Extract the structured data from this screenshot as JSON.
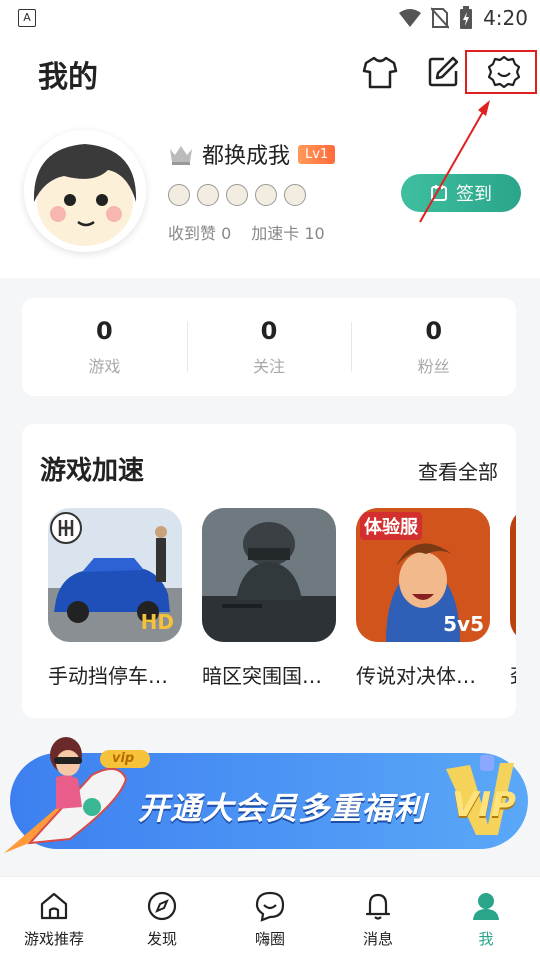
{
  "status": {
    "app_icon_letter": "A",
    "time": "4:20"
  },
  "header": {
    "title": "我的"
  },
  "profile": {
    "username": "都换成我",
    "level": "Lv1",
    "likes_label": "收到赞 0",
    "boost_label": "加速卡 10",
    "checkin_label": "签到"
  },
  "stats": [
    {
      "value": "0",
      "label": "游戏"
    },
    {
      "value": "0",
      "label": "关注"
    },
    {
      "value": "0",
      "label": "粉丝"
    }
  ],
  "accel": {
    "title": "游戏加速",
    "view_all": "查看全部",
    "games": [
      {
        "name": "手动挡停车…",
        "badge": "HD"
      },
      {
        "name": "暗区突围国…"
      },
      {
        "name": "传说对决体…",
        "badge_top": "体验服",
        "badge_bottom": "5v5"
      },
      {
        "name": "劲"
      }
    ]
  },
  "banner": {
    "text": "开通大会员多重福利",
    "vip": "VIP",
    "tag": "vip"
  },
  "tabs": [
    {
      "label": "游戏推荐",
      "icon": "home-icon"
    },
    {
      "label": "发现",
      "icon": "compass-icon"
    },
    {
      "label": "嗨圈",
      "icon": "chat-icon"
    },
    {
      "label": "消息",
      "icon": "bell-icon"
    },
    {
      "label": "我",
      "icon": "person-icon",
      "active": true
    }
  ],
  "colors": {
    "accent": "#2aa58a",
    "highlight": "#e02020"
  }
}
